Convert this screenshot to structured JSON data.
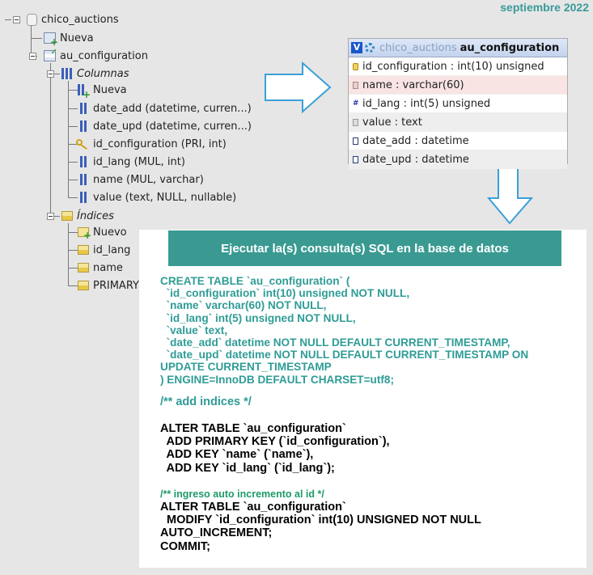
{
  "date_label": "septiembre 2022",
  "tree": {
    "db": "chico_auctions",
    "new_table": "Nueva",
    "table": "au_configuration",
    "columns_group": "Columnas",
    "new_column": "Nueva",
    "columns": [
      "date_add (datetime, curren...)",
      "date_upd (datetime, curren...)",
      "id_configuration (PRI, int)",
      "id_lang (MUL, int)",
      "name (MUL, varchar)",
      "value (text, NULL, nullable)"
    ],
    "indexes_group": "Índices",
    "new_index": "Nuevo",
    "indexes": [
      "id_lang",
      "name",
      "PRIMARY"
    ]
  },
  "table_card": {
    "badge": "V",
    "db": "chico_auctions",
    "table": "au_configuration",
    "fields": [
      {
        "text": "id_configuration : int(10) unsigned",
        "icon": "key"
      },
      {
        "text": "name : varchar(60)",
        "icon": "str"
      },
      {
        "text": "id_lang : int(5) unsigned",
        "icon": "num"
      },
      {
        "text": "value : text",
        "icon": "txt"
      },
      {
        "text": "date_add : datetime",
        "icon": "dt"
      },
      {
        "text": "date_upd : datetime",
        "icon": "dt"
      }
    ]
  },
  "sql_panel": {
    "title": "Ejecutar la(s) consulta(s) SQL en la base de datos",
    "create_sql": "CREATE TABLE `au_configuration` (\n  `id_configuration` int(10) unsigned NOT NULL,\n  `name` varchar(60) NOT NULL,\n  `id_lang` int(5) unsigned NOT NULL,\n  `value` text,\n  `date_add` datetime NOT NULL DEFAULT CURRENT_TIMESTAMP,\n  `date_upd` datetime NOT NULL DEFAULT CURRENT_TIMESTAMP ON\nUPDATE CURRENT_TIMESTAMP\n) ENGINE=InnoDB DEFAULT CHARSET=utf8;",
    "comment_indices": "/** add indices */",
    "alter_indices": "ALTER TABLE `au_configuration`\n  ADD PRIMARY KEY (`id_configuration`),\n  ADD KEY `name` (`name`),\n  ADD KEY `id_lang` (`id_lang`);",
    "comment_autoinc": "/** ingreso auto incremento al id */",
    "alter_autoinc": "ALTER TABLE `au_configuration`\n  MODIFY `id_configuration` int(10) UNSIGNED NOT NULL\nAUTO_INCREMENT;\nCOMMIT;"
  },
  "colors": {
    "accent": "#3a9a92",
    "sql_teal": "#2f9c96",
    "comment_green": "#1e9a6a"
  }
}
